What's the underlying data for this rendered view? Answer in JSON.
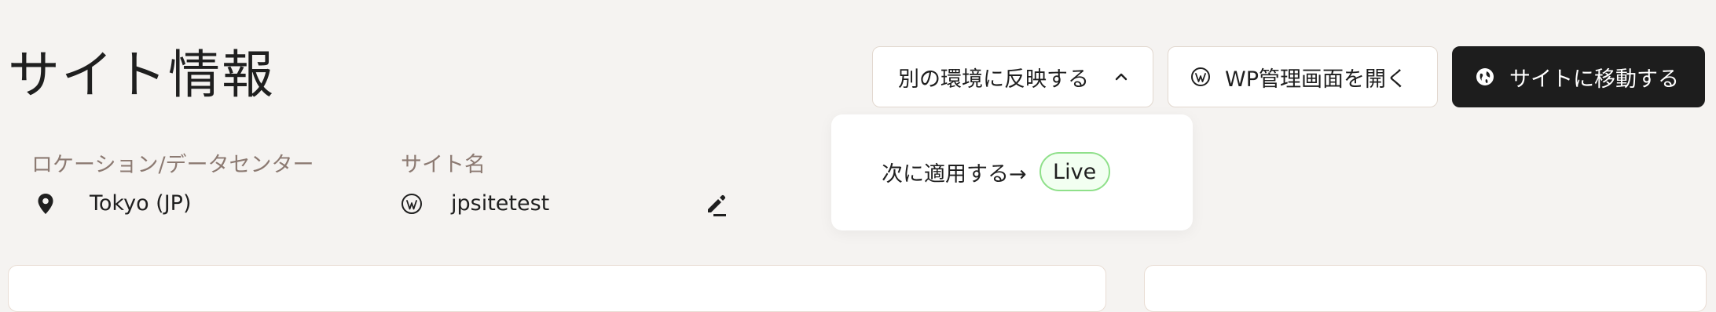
{
  "page": {
    "title": "サイト情報"
  },
  "actions": {
    "reflect_label": "別の環境に反映する",
    "wp_admin_label": "WP管理画面を開く",
    "visit_site_label": "サイトに移動する"
  },
  "dropdown": {
    "apply_to_label": "次に適用する→",
    "target_environment": "Live"
  },
  "details": {
    "location": {
      "label": "ロケーション/データセンター",
      "value": "Tokyo (JP)"
    },
    "site_name": {
      "label": "サイト名",
      "value": "jpsitetest"
    }
  },
  "icons": {
    "reflect_chevron": "chevron-up-icon",
    "wp_admin": "wordpress-icon",
    "visit_site": "globe-icon",
    "location": "map-pin-icon",
    "site_name": "wordpress-icon",
    "edit": "edit-pencil-icon"
  },
  "colors": {
    "background": "#f5f3f1",
    "primary_button": "#1d1d1d",
    "label_text": "#8c7a72",
    "live_badge_border": "#8fe08a"
  }
}
